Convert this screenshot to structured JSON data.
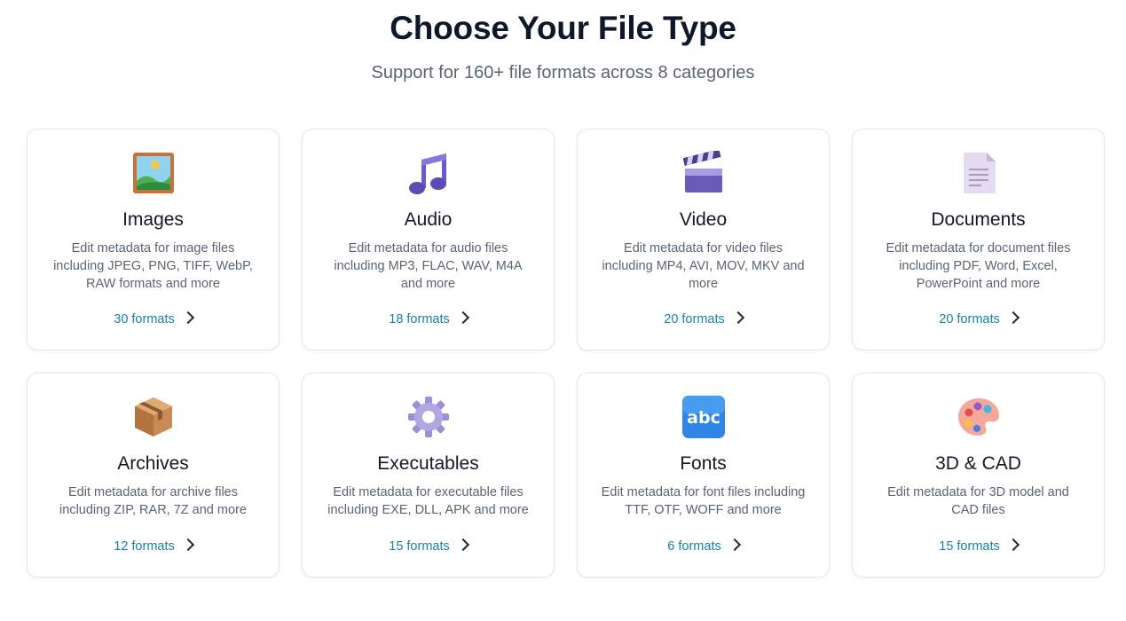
{
  "header": {
    "title": "Choose Your File Type",
    "subtitle": "Support for 160+ file formats across 8 categories"
  },
  "colors": {
    "link": "#1a7fa6",
    "title": "#0f172a",
    "muted": "#5b6472",
    "border": "#e5e7eb"
  },
  "categories": [
    {
      "icon": "framed-picture-icon",
      "title": "Images",
      "description": "Edit metadata for image files including JPEG, PNG, TIFF, WebP, RAW formats and more",
      "formats": "30 formats"
    },
    {
      "icon": "music-note-icon",
      "title": "Audio",
      "description": "Edit metadata for audio files including MP3, FLAC, WAV, M4A and more",
      "formats": "18 formats"
    },
    {
      "icon": "clapper-board-icon",
      "title": "Video",
      "description": "Edit metadata for video files including MP4, AVI, MOV, MKV and more",
      "formats": "20 formats"
    },
    {
      "icon": "document-icon",
      "title": "Documents",
      "description": "Edit metadata for document files including PDF, Word, Excel, PowerPoint and more",
      "formats": "20 formats"
    },
    {
      "icon": "package-box-icon",
      "title": "Archives",
      "description": "Edit metadata for archive files including ZIP, RAR, 7Z and more",
      "formats": "12 formats"
    },
    {
      "icon": "gear-icon",
      "title": "Executables",
      "description": "Edit metadata for executable files including EXE, DLL, APK and more",
      "formats": "15 formats"
    },
    {
      "icon": "abc-icon",
      "title": "Fonts",
      "description": "Edit metadata for font files including TTF, OTF, WOFF and more",
      "formats": "6 formats"
    },
    {
      "icon": "artist-palette-icon",
      "title": "3D & CAD",
      "description": "Edit metadata for 3D model and CAD files",
      "formats": "15 formats"
    }
  ]
}
